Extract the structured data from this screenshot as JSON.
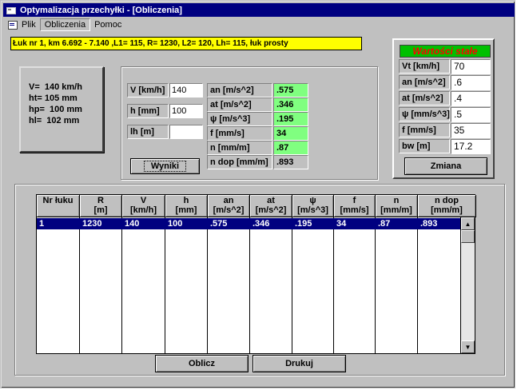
{
  "title": "Optymalizacja przechyłki - [Obliczenia]",
  "menu": [
    "Plik",
    "Obliczenia",
    "Pomoc"
  ],
  "info": "Łuk nr 1, km 6.692 - 7.140 ,L1= 115, R= 1230, L2= 120, Lh= 115, łuk prosty",
  "summary": [
    "V=  140 km/h",
    "ht= 105 mm",
    "hp=  100 mm",
    "hl=  102 mm"
  ],
  "inputs": {
    "v_label": "V [km/h]",
    "v_value": "140",
    "h_label": "h [mm]",
    "h_value": "100",
    "lh_label": "lh [m]",
    "lh_value": ""
  },
  "results": [
    {
      "label": "an [m/s^2]",
      "value": ".575"
    },
    {
      "label": "at [m/s^2]",
      "value": ".346"
    },
    {
      "label": "ψ  [m/s^3]",
      "value": ".195"
    },
    {
      "label": "f [mm/s]",
      "value": "34"
    },
    {
      "label": "n [mm/m]",
      "value": ".87"
    },
    {
      "label": "n dop [mm/m]",
      "value": ".893"
    }
  ],
  "wyniki_button": "Wyniki",
  "constants_title": "Wartości stałe",
  "constants": [
    {
      "label": "Vt [km/h]",
      "value": "70"
    },
    {
      "label": "an [m/s^2]",
      "value": ".6"
    },
    {
      "label": "at [m/s^2]",
      "value": ".4"
    },
    {
      "label": "ψ [mm/s^3]",
      "value": ".5"
    },
    {
      "label": "f [mm/s]",
      "value": "35"
    },
    {
      "label": "bw [m]",
      "value": "17.2"
    }
  ],
  "zmiana_button": "Zmiana",
  "table": {
    "headers": [
      [
        "Nr łuku",
        ""
      ],
      [
        "R",
        "[m]"
      ],
      [
        "V",
        "[km/h]"
      ],
      [
        "h",
        "[mm]"
      ],
      [
        "an",
        "[m/s^2]"
      ],
      [
        "at",
        "[m/s^2]"
      ],
      [
        "ψ",
        "[m/s^3]"
      ],
      [
        "f",
        "[mm/s]"
      ],
      [
        "n",
        "[mm/m]"
      ],
      [
        "n  dop",
        "[mm/m]"
      ]
    ],
    "rows": [
      [
        "1",
        "1230",
        "140",
        "100",
        ".575",
        ".346",
        ".195",
        "34",
        ".87",
        ".893"
      ]
    ]
  },
  "oblicz_button": "Oblicz",
  "drukuj_button": "Drukuj",
  "colors": {
    "titlebar": "#000080",
    "info_bg": "#ffff00",
    "result_bg": "#80ff80",
    "const_title_bg": "#00c000",
    "const_title_fg": "#ff0000"
  }
}
